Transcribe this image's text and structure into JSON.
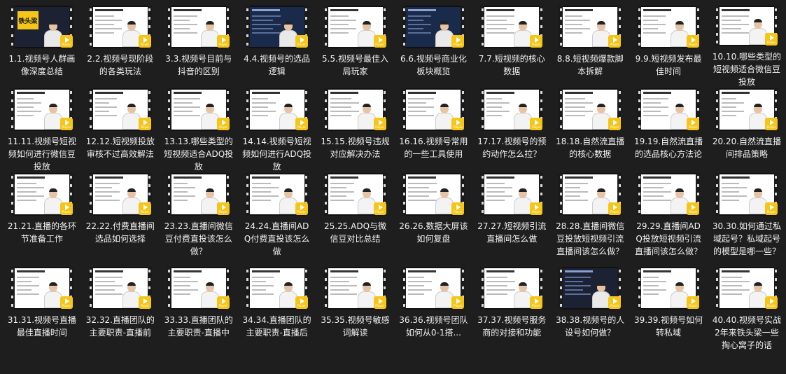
{
  "items": [
    {
      "title": "1.1.视频号人群画像深度总结",
      "style": "dark"
    },
    {
      "title": "2.2.视频号现阶段的各类玩法",
      "style": "light"
    },
    {
      "title": "3.3.视频号目前与抖音的区别",
      "style": "light"
    },
    {
      "title": "4.4.视频号的选品逻辑",
      "style": "blue"
    },
    {
      "title": "5.5.视频号最佳入局玩家",
      "style": "light"
    },
    {
      "title": "6.6.视频号商业化板块概览",
      "style": "blue"
    },
    {
      "title": "7.7.短视频的核心数据",
      "style": "light"
    },
    {
      "title": "8.8.短视频爆款脚本拆解",
      "style": "light"
    },
    {
      "title": "9.9.短视频发布最佳时间",
      "style": "light"
    },
    {
      "title": "10.10.哪些类型的短视频适合微信豆投放",
      "style": "light"
    },
    {
      "title": "11.11.视频号短视频如何进行微信豆投放",
      "style": "light"
    },
    {
      "title": "12.12.短视频投放审核不过高效解法",
      "style": "light"
    },
    {
      "title": "13.13.哪些类型的短视频适合ADQ投放",
      "style": "light"
    },
    {
      "title": "14.14.视频号短视频如何进行ADQ投放",
      "style": "light"
    },
    {
      "title": "15.15.视频号违规对应解决办法",
      "style": "light"
    },
    {
      "title": "16.16.视频号常用的一些工具使用",
      "style": "light"
    },
    {
      "title": "17.17.视频号的预约动作怎么拉？",
      "style": "light"
    },
    {
      "title": "18.18.自然流直播的核心数据",
      "style": "light"
    },
    {
      "title": "19.19.自然流直播的选品核心方法论",
      "style": "light"
    },
    {
      "title": "20.20.自然流直播间排品策略",
      "style": "light"
    },
    {
      "title": "21.21.直播的各环节准备工作",
      "style": "light"
    },
    {
      "title": "22.22.付费直播间选品如何选择",
      "style": "light"
    },
    {
      "title": "23.23.直播间微信豆付费直投该怎么做？",
      "style": "light"
    },
    {
      "title": "24.24.直播间ADQ付费直投该怎么做",
      "style": "light"
    },
    {
      "title": "25.25.ADQ与微信豆对比总结",
      "style": "light"
    },
    {
      "title": "26.26.数据大屏该如何复盘",
      "style": "light"
    },
    {
      "title": "27.27.短视频引流直播间怎么做",
      "style": "light"
    },
    {
      "title": "28.28.直播间微信豆投放短视频引流直播间该怎么做？",
      "style": "light"
    },
    {
      "title": "29.29.直播间ADQ投放短视频引流直播间该怎么做？",
      "style": "light"
    },
    {
      "title": "30.30.如何通过私域起号？私域起号的模型是哪一些？",
      "style": "light"
    },
    {
      "title": "31.31.视频号直播最佳直播时间",
      "style": "light"
    },
    {
      "title": "32.32.直播团队的主要职责-直播前",
      "style": "light"
    },
    {
      "title": "33.33.直播团队的主要职责-直播中",
      "style": "light"
    },
    {
      "title": "34.34.直播团队的主要职责-直播后",
      "style": "light"
    },
    {
      "title": "35.35.视频号敏感词解读",
      "style": "light"
    },
    {
      "title": "36.36.视频号团队如何从0-1搭...",
      "style": "light"
    },
    {
      "title": "37.37.视频号服务商的对接和功能",
      "style": "light"
    },
    {
      "title": "38.38.视频号的人设号如何做？",
      "style": "dark"
    },
    {
      "title": "39.39.视频号如何转私域",
      "style": "light"
    },
    {
      "title": "40.40.视频号实战2年来铁头梁一些掏心窝子的话",
      "style": "light"
    }
  ],
  "badge_text": "Player",
  "logo_text": "铁头梁"
}
